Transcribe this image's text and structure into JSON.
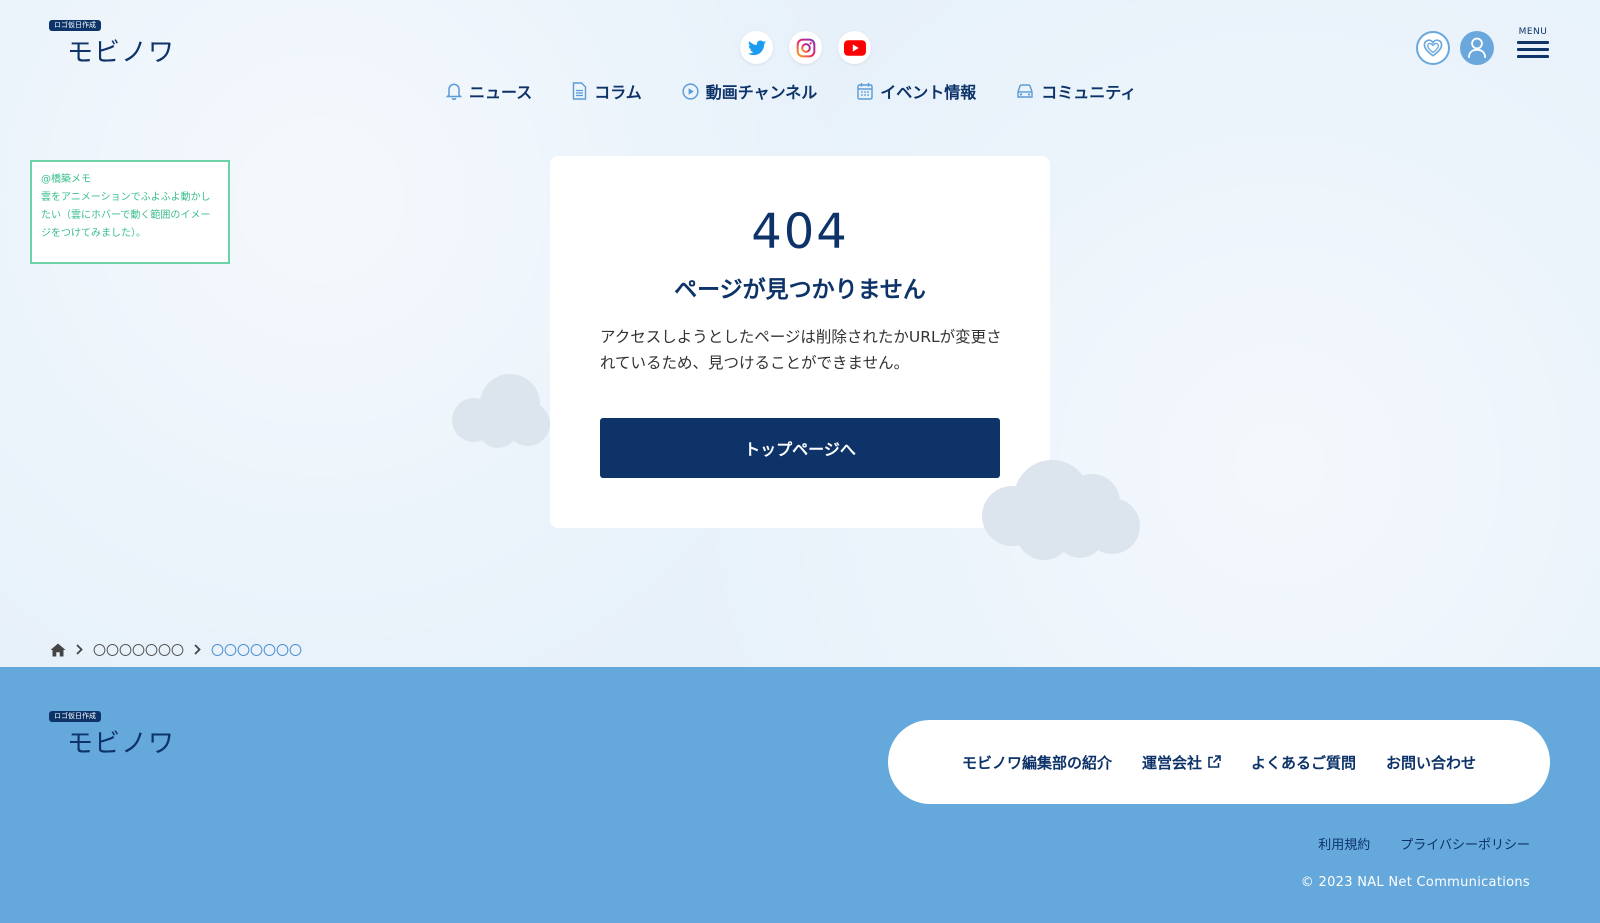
{
  "header": {
    "logo_badge": "ロゴ仮日作成",
    "logo_text": "モビノワ",
    "menu_label": "MENU"
  },
  "nav": {
    "items": [
      {
        "label": "ニュース",
        "icon": "bell-icon"
      },
      {
        "label": "コラム",
        "icon": "document-icon"
      },
      {
        "label": "動画チャンネル",
        "icon": "play-circle-icon"
      },
      {
        "label": "イベント情報",
        "icon": "calendar-icon"
      },
      {
        "label": "コミュニティ",
        "icon": "car-icon"
      }
    ]
  },
  "memo": {
    "text": "@橋築メモ\n雲をアニメーションでふよふよ動かしたい（雲にホバーで動く範囲のイメージをつけてみました）。"
  },
  "error": {
    "code": "404",
    "title": "ページが見つかりません",
    "message": "アクセスしようとしたページは削除されたかURLが変更されているため、見つけることができません。",
    "button_label": "トップページへ"
  },
  "breadcrumb": {
    "items": [
      "〇〇〇〇〇〇〇",
      "〇〇〇〇〇〇〇"
    ]
  },
  "footer": {
    "logo_badge": "ロゴ仮日作成",
    "logo_text": "モビノワ",
    "links": [
      "モビノワ編集部の紹介",
      "運営会社",
      "よくあるご質問",
      "お問い合わせ"
    ],
    "legal": [
      "利用規約",
      "プライバシーポリシー"
    ],
    "copyright": "© 2023 NAL Net Communications"
  },
  "colors": {
    "primary": "#0d3369",
    "accent": "#64a8dc",
    "memo_border": "#6dd2a8"
  }
}
